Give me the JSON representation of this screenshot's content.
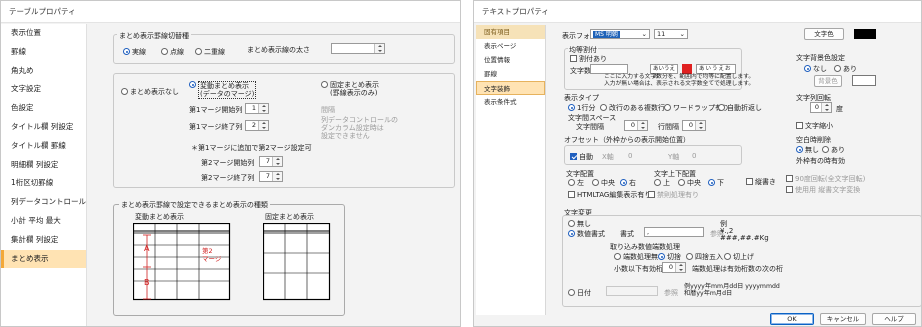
{
  "left": {
    "title": "テーブルプロパティ",
    "sidebar": [
      "表示位置",
      "罫線",
      "角丸め",
      "文字設定",
      "色設定",
      "タイトル欄 列設定",
      "タイトル欄 罫線",
      "明細欄 列設定",
      "1桁区切罫線",
      "列データコントロール",
      "小計 平均 最大",
      "集計欄 列設定",
      "まとめ表示"
    ],
    "switch_group": "まとめ表示罫線切替種",
    "line_opts": [
      "実線",
      "点線",
      "二重線"
    ],
    "thickness_label": "まとめ表示線の太さ",
    "no_merge": "まとめ表示なし",
    "var_merge": "変動まとめ表示\n(データのマージ)",
    "fix_merge": "固定まとめ表示\n(罫線表示のみ)",
    "m1_start": "第1マージ開始列",
    "m1_start_val": "1",
    "m1_end": "第1マージ終了列",
    "m1_end_val": "2",
    "spacing": "間隔",
    "note": "列データコントロールの\nダンカラム設定時は\n設定できません",
    "second_note": "＊第1マージに追加で第2マージ設定可",
    "m2_start": "第2マージ開始列",
    "m2_start_val": "7",
    "m2_end": "第2マージ終了列",
    "m2_end_val": "7",
    "types_title": "まとめ表示罫線で設定できるまとめ表示の種類",
    "var_caption": "変動まとめ表示",
    "fix_caption": "固定まとめ表示",
    "fig_a": "A",
    "fig_b": "B",
    "fig_m2": "第2\nマージ"
  },
  "right": {
    "title": "テキストプロパティ",
    "sidebar_header": "固有項目",
    "sidebar": [
      "表示ページ",
      "位置情報",
      "罫線",
      "文字装飾",
      "表示条件式"
    ],
    "font_label": "表示フォント",
    "font_value": "MS 明朝",
    "size_value": "11",
    "text_color": "文字色",
    "justify": "均等割付",
    "wrap": "割付あり",
    "char_count": "文字数",
    "sample1": "あいうえお",
    "sample2": "あいうえお",
    "sample3": "あいうえお",
    "explain": "ここに入力する文字数分を、範囲内で均等に配置します。\n入力が無い場合は、表示される文字数全てで処理します。",
    "bg_label": "文字背景色設定",
    "none": "なし",
    "yes": "あり",
    "bg_color": "背景色",
    "display_type": "表示タイプ",
    "type_opts": [
      "1行分",
      "改行のある複数行",
      "ワードラップ有り",
      "自動折返し"
    ],
    "spacing_label": "文字間スペース",
    "char_spacing": "文字間隔",
    "char_spacing_val": "0",
    "line_spacing": "行間隔",
    "line_spacing_val": "0",
    "rotation": "文字列回転",
    "rotation_val": "0",
    "degree": "度",
    "shrink": "文字縮小",
    "offset": "オフセット（外枠からの表示開始位置）",
    "auto": "自動",
    "x_label": "X軸",
    "x_val": "0",
    "y_label": "Y軸",
    "y_val": "0",
    "blank_delete": "空白時削除",
    "blank_opts": [
      "無し",
      "あり"
    ],
    "blank_note": "外枠有の時有効",
    "h_align": "文字配置",
    "h_opts": [
      "左",
      "中央",
      "右"
    ],
    "v_align": "文字上下配置",
    "v_opts": [
      "上",
      "中央",
      "下"
    ],
    "vertical": "縦書き",
    "vert_opts": [
      "90度回転(全文字回転)",
      "使用用 縦書文字変換"
    ],
    "html_tag": "HTMLTAG編集表示有り",
    "forbid": "禁則処理有り",
    "conv": "文字変更",
    "conv_none": "無し",
    "conv_num": "数値書式",
    "format_label": "書式",
    "format_val": ",",
    "ref": "参照",
    "example": "例\n¥.,2\n###,##.#Kg",
    "round_title": "取り込み数値端数処理",
    "round_opts": [
      "端数処理無",
      "切捨",
      "四捨五入",
      "切上げ"
    ],
    "decimal_label": "小数以下有効桁",
    "decimal_val": "0",
    "round_note": "端数処理は有効桁数の次の桁",
    "date_label": "日付",
    "date_ref": "参照",
    "date_example": "例yyyy年mm月dd日 yyyymmdd\n和暦yy年m月d日",
    "ok": "OK",
    "cancel": "キャンセル",
    "help": "ヘルプ"
  }
}
